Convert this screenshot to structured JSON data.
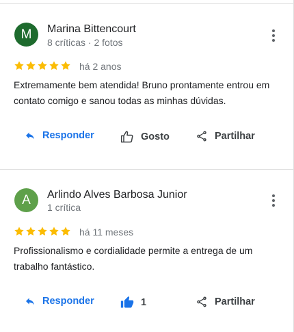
{
  "reviews": [
    {
      "avatar_letter": "M",
      "avatar_color": "#1e6b2e",
      "name": "Marina Bittencourt",
      "meta": "8 críticas · 2 fotos",
      "rating": 5,
      "when": "há 2 anos",
      "text": "Extremamente bem atendida! Bruno prontamente entrou em contato comigo e sanou todas as minhas dúvidas.",
      "actions": {
        "reply": "Responder",
        "like": "Gosto",
        "share": "Partilhar"
      },
      "liked": false
    },
    {
      "avatar_letter": "A",
      "avatar_color": "#5ea04a",
      "name": "Arlindo Alves Barbosa Junior",
      "meta": "1 crítica",
      "rating": 5,
      "when": "há 11 meses",
      "text": "Profissionalismo e cordialidade permite a entrega de um trabalho fantástico.",
      "actions": {
        "reply": "Responder",
        "like": "1",
        "share": "Partilhar"
      },
      "liked": true
    }
  ],
  "colors": {
    "star": "#fbbc04",
    "accent": "#1a73e8",
    "divider": "#e0e0e0"
  },
  "icons": {
    "reply": "reply-arrow-icon",
    "like": "thumbs-up-icon",
    "share": "share-icon",
    "more": "more-vert-icon",
    "star": "star-icon"
  }
}
